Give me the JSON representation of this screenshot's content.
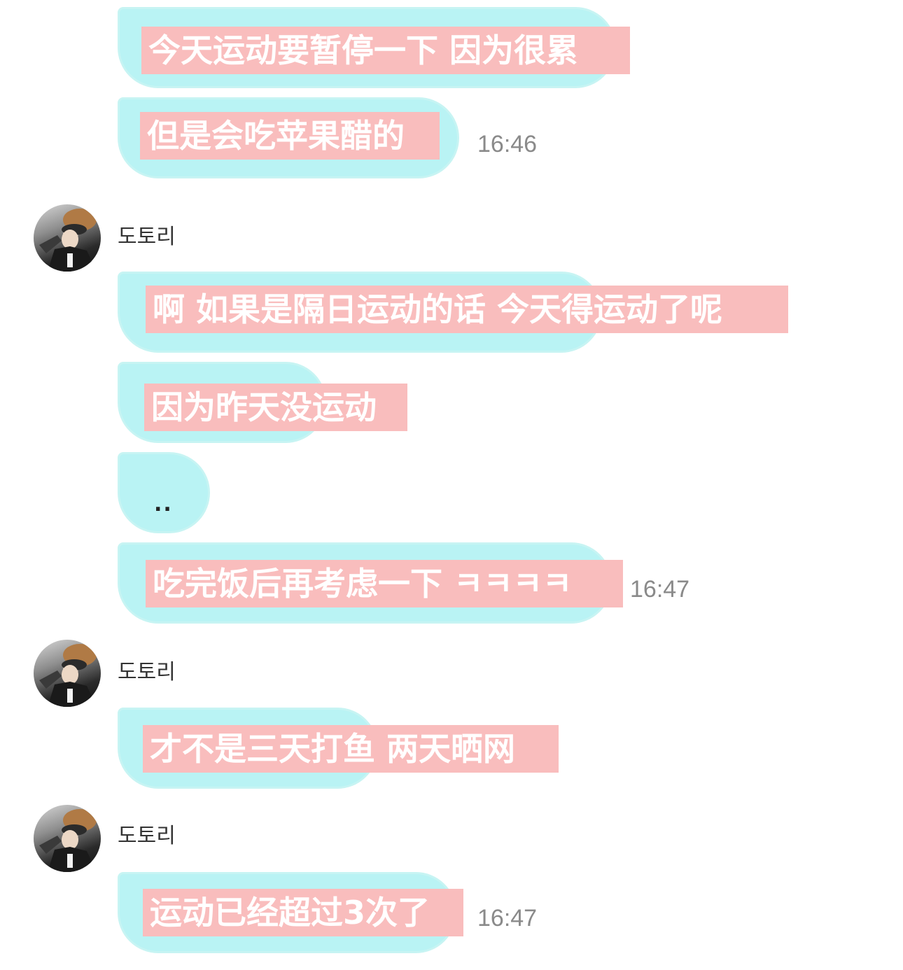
{
  "messages": {
    "m1": "今天运动要暂停一下 因为很累",
    "m2": "但是会吃苹果醋的",
    "m2_time": "16:46",
    "sender1": "도토리",
    "m3": "啊 如果是隔日运动的话 今天得运动了呢",
    "m4": "因为昨天没运动",
    "m5": "..",
    "m6": "吃完饭后再考虑一下 ㅋㅋㅋㅋ",
    "m6_time": "16:47",
    "sender2": "도토리",
    "m7": "才不是三天打鱼 两天晒网",
    "sender3": "도토리",
    "m8": "运动已经超过3次了",
    "m8_time": "16:47"
  },
  "colors": {
    "bubble": "#b9f3f4",
    "highlight": "#f9bdbd",
    "timestamp": "#8a8a8a"
  },
  "icons": {
    "avatar": "avatar-photo-icon"
  }
}
